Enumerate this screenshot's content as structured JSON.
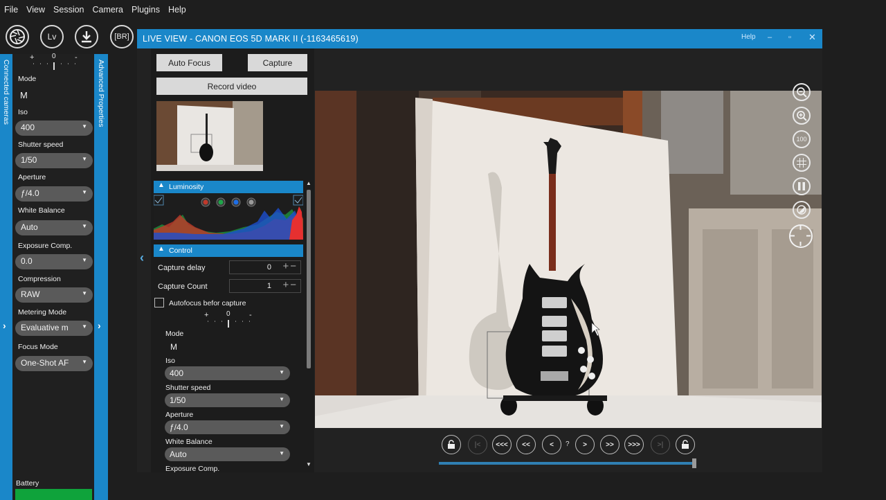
{
  "menu": [
    "File",
    "View",
    "Session",
    "Camera",
    "Plugins",
    "Help"
  ],
  "toolbar": {
    "lv_label": "Lv",
    "br_label": "[BR]"
  },
  "left_tabs": {
    "connected": "Connected cameras",
    "advanced": "Advanced Properties"
  },
  "left_panel": {
    "exposure_scale": {
      "plus": "+",
      "zero": "0",
      "minus": "-"
    },
    "mode_label": "Mode",
    "mode_value": "M",
    "iso_label": "Iso",
    "iso_value": "400",
    "shutter_label": "Shutter speed",
    "shutter_value": "1/50",
    "aperture_label": "Aperture",
    "aperture_value": "ƒ/4.0",
    "wb_label": "White Balance",
    "wb_value": "Auto",
    "exp_label": "Exposure Comp.",
    "exp_value": "0.0",
    "compression_label": "Compression",
    "compression_value": "RAW",
    "metering_label": "Metering Mode",
    "metering_value": "Evaluative m",
    "focus_label": "Focus Mode",
    "focus_value": "One-Shot AF",
    "battery_label": "Battery"
  },
  "liveview": {
    "title": "LIVE VIEW - CANON EOS 5D MARK II (-1163465619)",
    "help": "Help",
    "auto_focus": "Auto Focus",
    "capture": "Capture",
    "record": "Record video",
    "luminosity": "Luminosity",
    "control": "Control",
    "capture_delay_label": "Capture delay",
    "capture_delay_value": "0",
    "capture_count_label": "Capture Count",
    "capture_count_value": "1",
    "autofocus_before": "Autofocus befor capture",
    "mode_label": "Mode",
    "mode_value": "M",
    "iso_label": "Iso",
    "iso_value": "400",
    "shutter_label": "Shutter speed",
    "shutter_value": "1/50",
    "aperture_label": "Aperture",
    "aperture_value": "ƒ/4.0",
    "wb_label": "White Balance",
    "wb_value": "Auto",
    "exp_label": "Exposure Comp.",
    "zoom_100": "100",
    "nav": {
      "first": "|<",
      "prev3": "<<<",
      "prev2": "<<",
      "prev": "<",
      "counter": "?",
      "next": ">",
      "next2": ">>",
      "next3": ">>>",
      "last": ">|"
    }
  },
  "colors": {
    "accent": "#1a87c9",
    "battery": "#0fa33b"
  }
}
